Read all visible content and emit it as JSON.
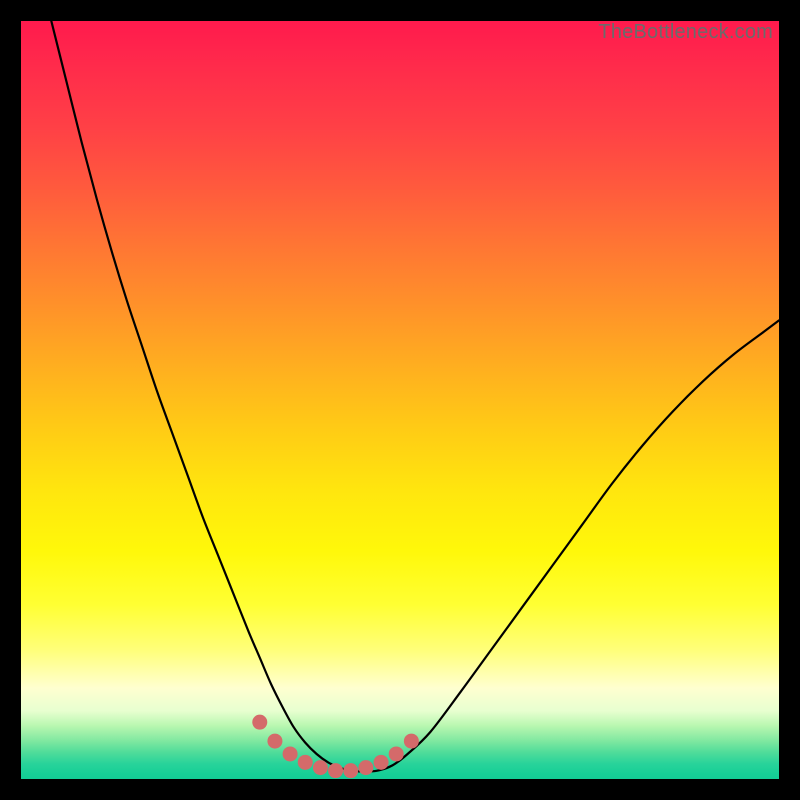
{
  "watermark": "TheBottleneck.com",
  "colors": {
    "frame": "#000000",
    "curve": "#000000",
    "marker_fill": "#d46a6a",
    "marker_stroke": "#c95c5c"
  },
  "chart_data": {
    "type": "line",
    "title": "",
    "xlabel": "",
    "ylabel": "",
    "xlim": [
      0,
      100
    ],
    "ylim": [
      0,
      100
    ],
    "x": [
      4,
      6,
      8,
      10,
      12,
      14,
      16,
      18,
      20,
      22,
      24,
      26,
      28,
      30,
      31.5,
      33,
      34.5,
      36,
      37.5,
      39,
      40.5,
      42,
      43.5,
      45,
      47,
      49,
      51,
      54,
      58,
      62,
      66,
      70,
      74,
      78,
      82,
      86,
      90,
      94,
      98,
      100
    ],
    "y": [
      100,
      92,
      84,
      76.5,
      69.5,
      63,
      57,
      51,
      45.5,
      40,
      34.5,
      29.5,
      24.5,
      19.5,
      16,
      12.5,
      9.5,
      6.8,
      4.8,
      3.3,
      2.2,
      1.5,
      1.1,
      1.0,
      1.1,
      1.8,
      3.3,
      6.2,
      11.5,
      17,
      22.5,
      28,
      33.5,
      39,
      44,
      48.5,
      52.5,
      56,
      59,
      60.5
    ],
    "markers": {
      "x": [
        31.5,
        33.5,
        35.5,
        37.5,
        39.5,
        41.5,
        43.5,
        45.5,
        47.5,
        49.5,
        51.5
      ],
      "y": [
        7.5,
        5.0,
        3.3,
        2.2,
        1.5,
        1.1,
        1.1,
        1.5,
        2.2,
        3.3,
        5.0
      ]
    }
  }
}
